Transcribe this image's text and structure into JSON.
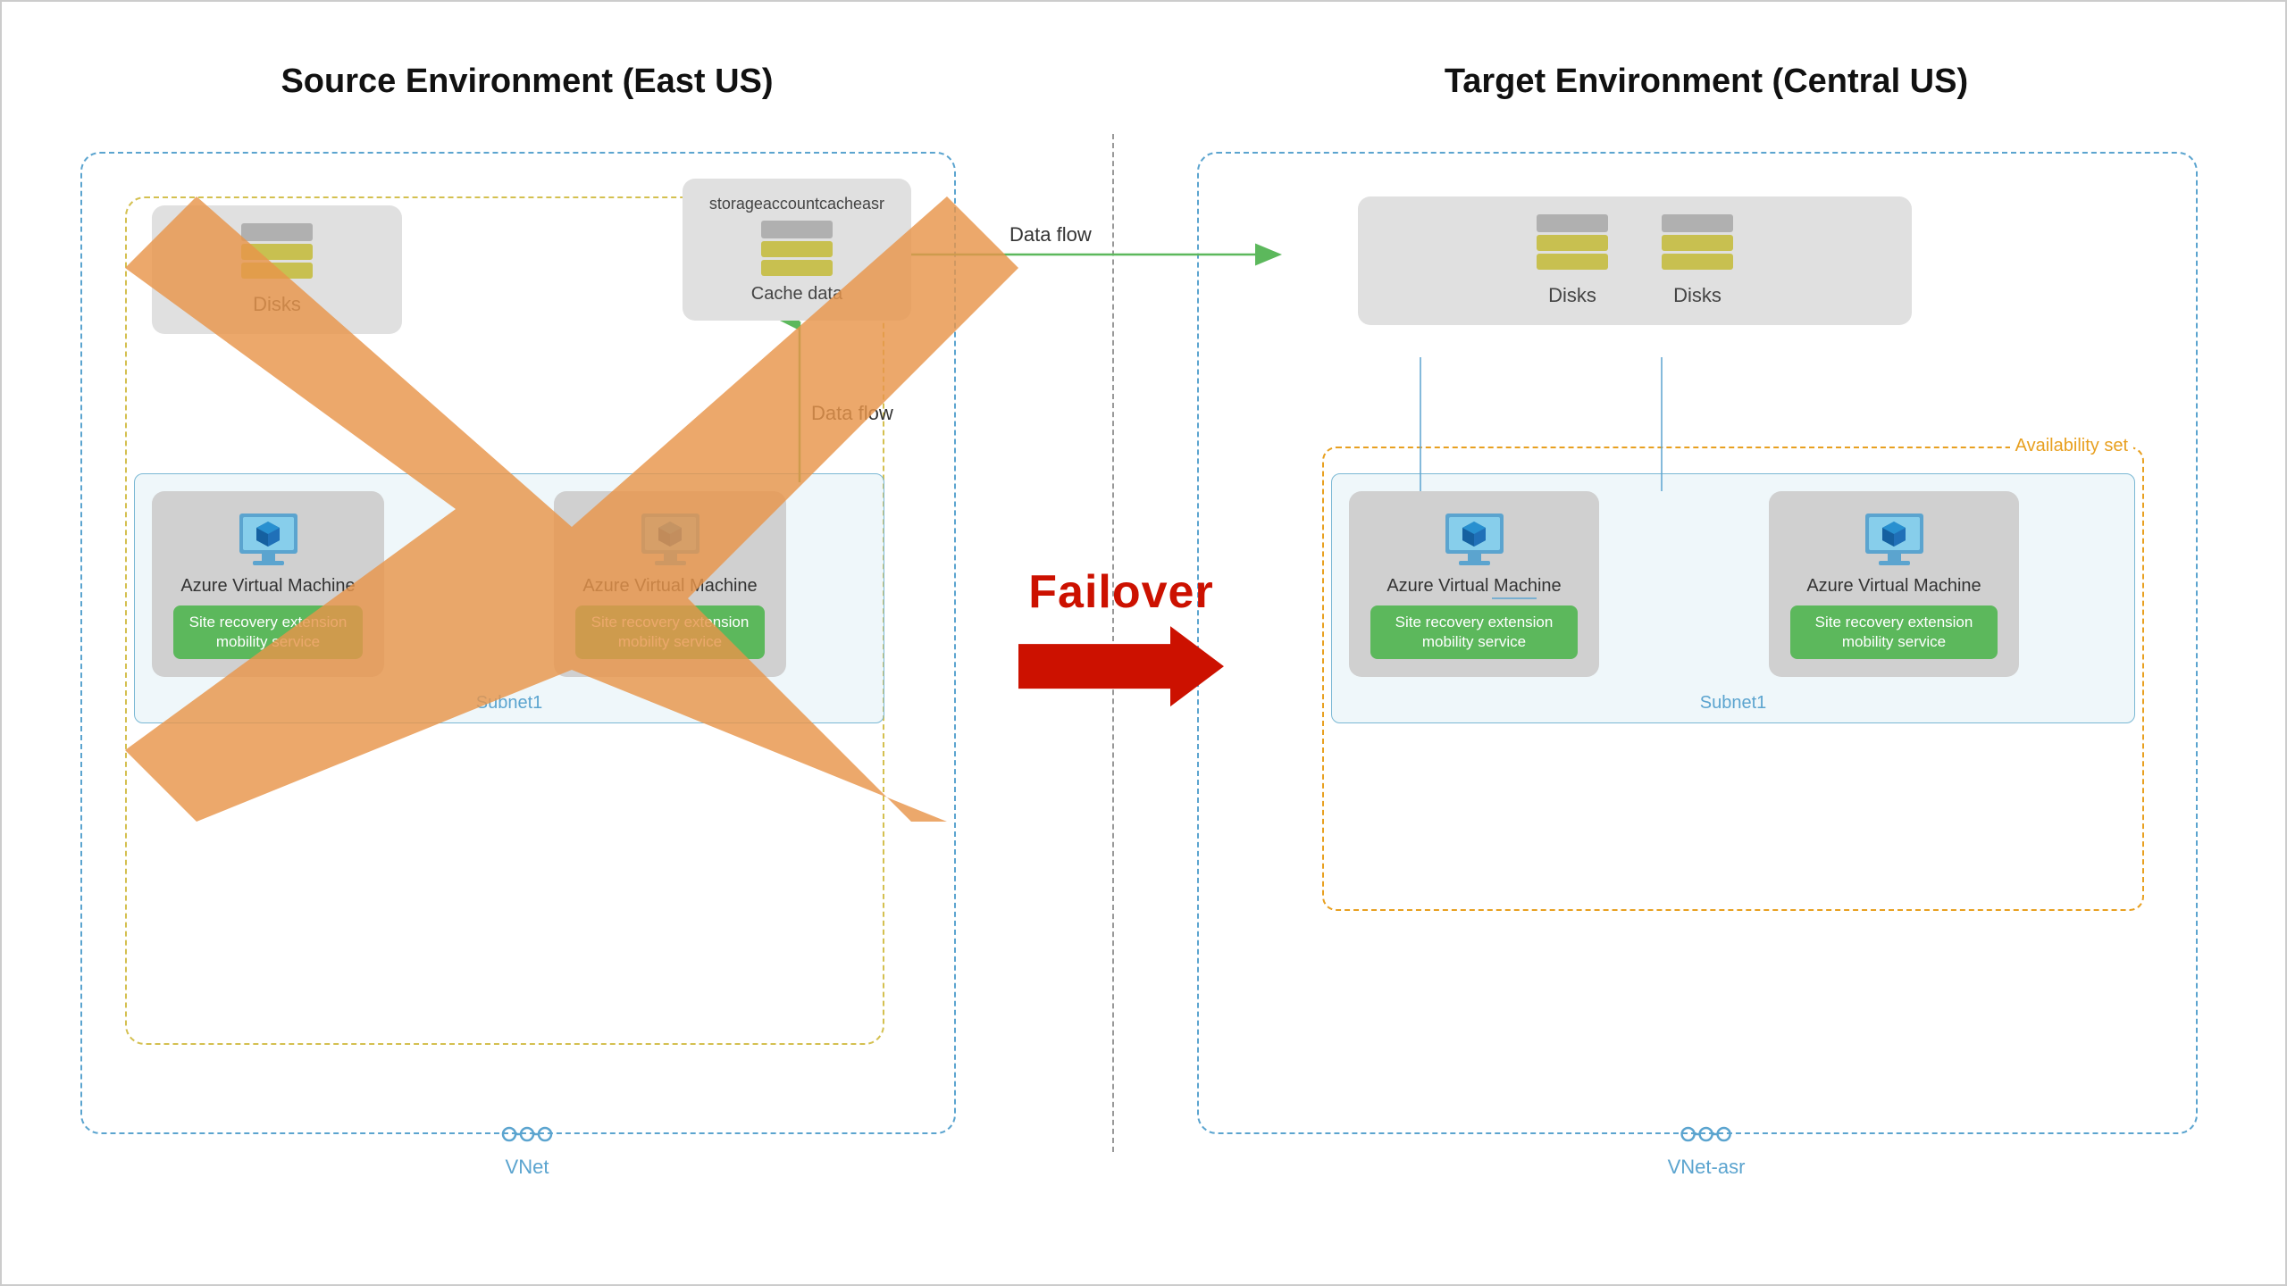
{
  "source": {
    "title": "Source Environment (East US)",
    "storage_label": "storageaccountcacheasr",
    "cache_label": "Cache data",
    "disks_label": "Disks",
    "vm1_label": "Azure Virtual Machine",
    "vm2_label": "Azure Virtual Machine",
    "mobility1": "Site recovery extension mobility service",
    "mobility2": "Site recovery extension mobility service",
    "subnet_label": "Subnet1",
    "vnet_label": "VNet"
  },
  "target": {
    "title": "Target Environment (Central US)",
    "disks1_label": "Disks",
    "disks2_label": "Disks",
    "vm1_label": "Azure Virtual Machine",
    "vm2_label": "Azure Virtual Machine",
    "mobility1": "Site recovery extension mobility service",
    "mobility2": "Site recovery extension mobility service",
    "subnet_label": "Subnet1",
    "vnet_label": "VNet-asr",
    "availability_set_label": "Availability set"
  },
  "arrows": {
    "data_flow_top": "Data flow",
    "data_flow_right": "Data flow"
  },
  "failover": {
    "label": "Failover"
  },
  "colors": {
    "green": "#5cb85c",
    "red_arrow": "#cc1100",
    "blue_dashed": "#5ba4cf",
    "orange_x": "#e8954a",
    "orange_avail": "#e8a020",
    "gray_bg": "#e0e0e0",
    "vm_bg": "#d0d0d0"
  }
}
